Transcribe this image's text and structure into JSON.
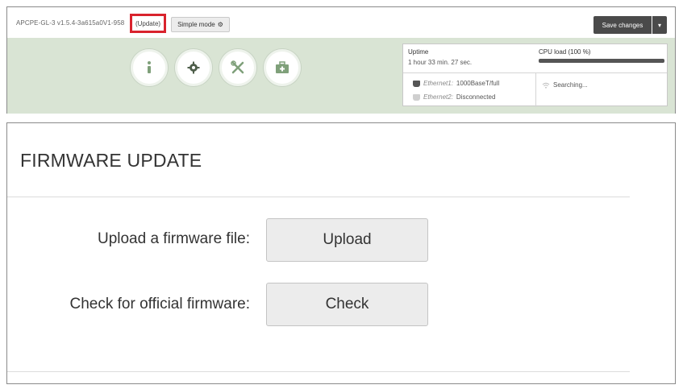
{
  "topbar": {
    "version": "APCPE-GL-3 v1.5.4-3a615a0V1-958",
    "update_link": "(Update)",
    "simple_mode": "Simple mode",
    "save_changes": "Save changes",
    "save_caret": "▾"
  },
  "toolbar": {
    "buttons": [
      {
        "name": "info-icon",
        "glyph": "i"
      },
      {
        "name": "gear-icon",
        "glyph": "⚙"
      },
      {
        "name": "tools-icon",
        "glyph": "✕"
      },
      {
        "name": "medkit-icon",
        "glyph": "+"
      }
    ]
  },
  "status": {
    "uptime_label": "Uptime",
    "uptime_value": "1 hour 33 min. 27 sec.",
    "cpu_label": "CPU load (100 %)",
    "cpu_fraction": 1.0,
    "ethernet1_name": "Ethernet1:",
    "ethernet1_status": "1000BaseT/full",
    "ethernet2_name": "Ethernet2:",
    "ethernet2_status": "Disconnected",
    "wifi_status": "Searching..."
  },
  "firmware": {
    "title": "FIRMWARE UPDATE",
    "upload_label": "Upload a firmware file:",
    "upload_button": "Upload",
    "check_label": "Check for official firmware:",
    "check_button": "Check"
  },
  "colors": {
    "highlight": "#d9232d",
    "toolbar_bg": "#d9e4d4",
    "icon": "#7fa07a",
    "save_button": "#4a4a4a"
  }
}
